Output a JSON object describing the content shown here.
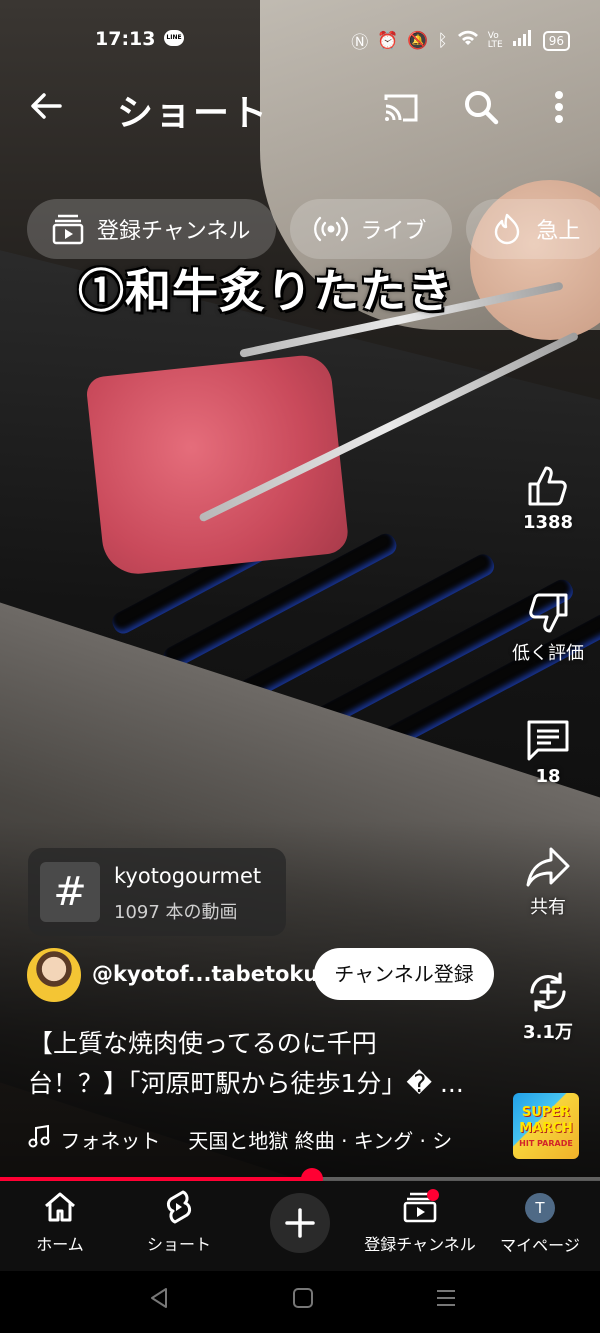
{
  "status_bar": {
    "time": "17:13",
    "battery": "96"
  },
  "header": {
    "title": "ショート"
  },
  "chips": [
    {
      "label": "登録チャンネル",
      "icon": "subscriptions-icon"
    },
    {
      "label": "ライブ",
      "icon": "live-icon"
    },
    {
      "label": "急上",
      "icon": "trending-icon"
    }
  ],
  "video": {
    "caption": "①和牛炙りたたき",
    "title_line1": "【上質な焼肉使ってるのに千円",
    "title_line2": "台！？】「河原町駅から徒歩1分」� ...",
    "progress": 0.52
  },
  "actions": {
    "likes": "1388",
    "dislike_label": "低く評価",
    "comments": "18",
    "share_label": "共有",
    "remix_count": "3.1万"
  },
  "hashtag": {
    "name": "kyotogourmet",
    "count_label": "1097 本の動画"
  },
  "channel": {
    "handle": "@kyotof...tabetoku",
    "subscribe_label": "チャンネル登録"
  },
  "music": {
    "track": "フォネット",
    "song": "天国と地獄 終曲 · キング · シ"
  },
  "album_art": {
    "line1": "SUPER",
    "line2": "MARCH",
    "line3": "HIT PARADE"
  },
  "bottom_nav": [
    {
      "label": "ホーム",
      "icon": "home-icon"
    },
    {
      "label": "ショート",
      "icon": "shorts-icon"
    },
    {
      "label": "",
      "icon": "create-icon"
    },
    {
      "label": "登録チャンネル",
      "icon": "subscriptions-icon"
    },
    {
      "label": "マイページ",
      "icon": "avatar",
      "avatar_letter": "T"
    }
  ],
  "colors": {
    "accent": "#ff0033",
    "nav_bg": "#0f0f0f"
  }
}
